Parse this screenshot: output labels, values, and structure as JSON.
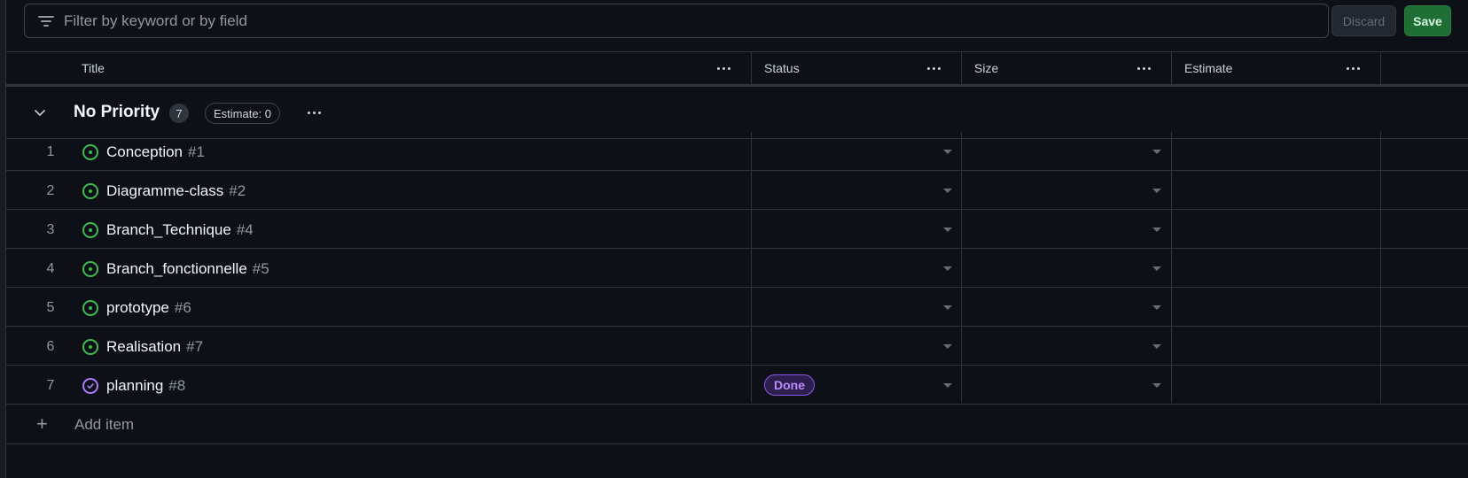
{
  "filter": {
    "placeholder": "Filter by keyword or by field",
    "discard_label": "Discard",
    "save_label": "Save"
  },
  "columns": [
    {
      "label": "Title"
    },
    {
      "label": "Status"
    },
    {
      "label": "Size"
    },
    {
      "label": "Estimate"
    }
  ],
  "group": {
    "title": "No Priority",
    "count": "7",
    "estimate_label": "Estimate: 0"
  },
  "rows": [
    {
      "num": "1",
      "title": "Conception",
      "issue": "#1",
      "state": "open",
      "status": ""
    },
    {
      "num": "2",
      "title": "Diagramme-class",
      "issue": "#2",
      "state": "open",
      "status": ""
    },
    {
      "num": "3",
      "title": "Branch_Technique",
      "issue": "#4",
      "state": "open",
      "status": ""
    },
    {
      "num": "4",
      "title": "Branch_fonctionnelle",
      "issue": "#5",
      "state": "open",
      "status": ""
    },
    {
      "num": "5",
      "title": "prototype",
      "issue": "#6",
      "state": "open",
      "status": ""
    },
    {
      "num": "6",
      "title": "Realisation",
      "issue": "#7",
      "state": "open",
      "status": ""
    },
    {
      "num": "7",
      "title": "planning",
      "issue": "#8",
      "state": "closed",
      "status": "Done"
    }
  ],
  "add_item_label": "Add item",
  "icons": {
    "filter": "filter-icon",
    "collapse": "chevron-down-icon",
    "menu": "kebab-menu-icon",
    "open_issue": "issue-open-icon",
    "closed_issue": "issue-closed-icon",
    "add": "plus-icon",
    "dropdown": "dropdown-caret-icon"
  },
  "colors": {
    "background": "#0d1117",
    "open_issue": "#3fb950",
    "closed_issue": "#ab7df8",
    "save_button": "#1f6f35",
    "done_badge": "#bc8cff"
  }
}
